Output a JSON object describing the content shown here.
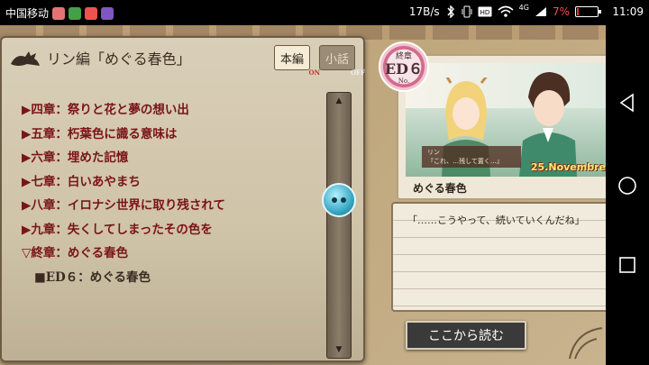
{
  "status_bar": {
    "carrier": "中国移动",
    "speed": "17B/s",
    "network": "4G",
    "battery_percent": "7%",
    "battery_level": 0.07,
    "time": "11:09",
    "icons": [
      "bluetooth-icon",
      "vibrate-icon",
      "hd-icon",
      "wifi-icon",
      "signal-icon",
      "battery-icon"
    ]
  },
  "book": {
    "title": "リン編「めぐる春色」",
    "toggle_main": {
      "label": "本編",
      "state": "ON"
    },
    "toggle_short": {
      "label": "小話",
      "state": "OFF"
    },
    "chapters": [
      "▶四章：祭りと花と夢の想い出",
      "▶五章：朽葉色に識る意味は",
      "▶六章：埋めた記憶",
      "▶七章：白いあやまち",
      "▶八章：イロナシ世界に取り残されて",
      "▶九章：失くしてしまったその色を",
      "▽終章：めぐる春色"
    ],
    "sub_item": "■ED６：めぐる春色"
  },
  "ending": {
    "badge_kind": "終章",
    "badge_num": "ED６",
    "badge_no": "No.",
    "thumb_speaker": "リン",
    "thumb_line": "『これ、…残して置く…』",
    "thumb_date": "25.Novembre",
    "caption": "めぐる春色"
  },
  "quote": "「……こうやって、続いていくんだね」",
  "read_button": "ここから読む",
  "colors": {
    "chapter_red": "#7a1418",
    "accent_blue": "#3aa9c4",
    "battery_red": "#e53935"
  }
}
